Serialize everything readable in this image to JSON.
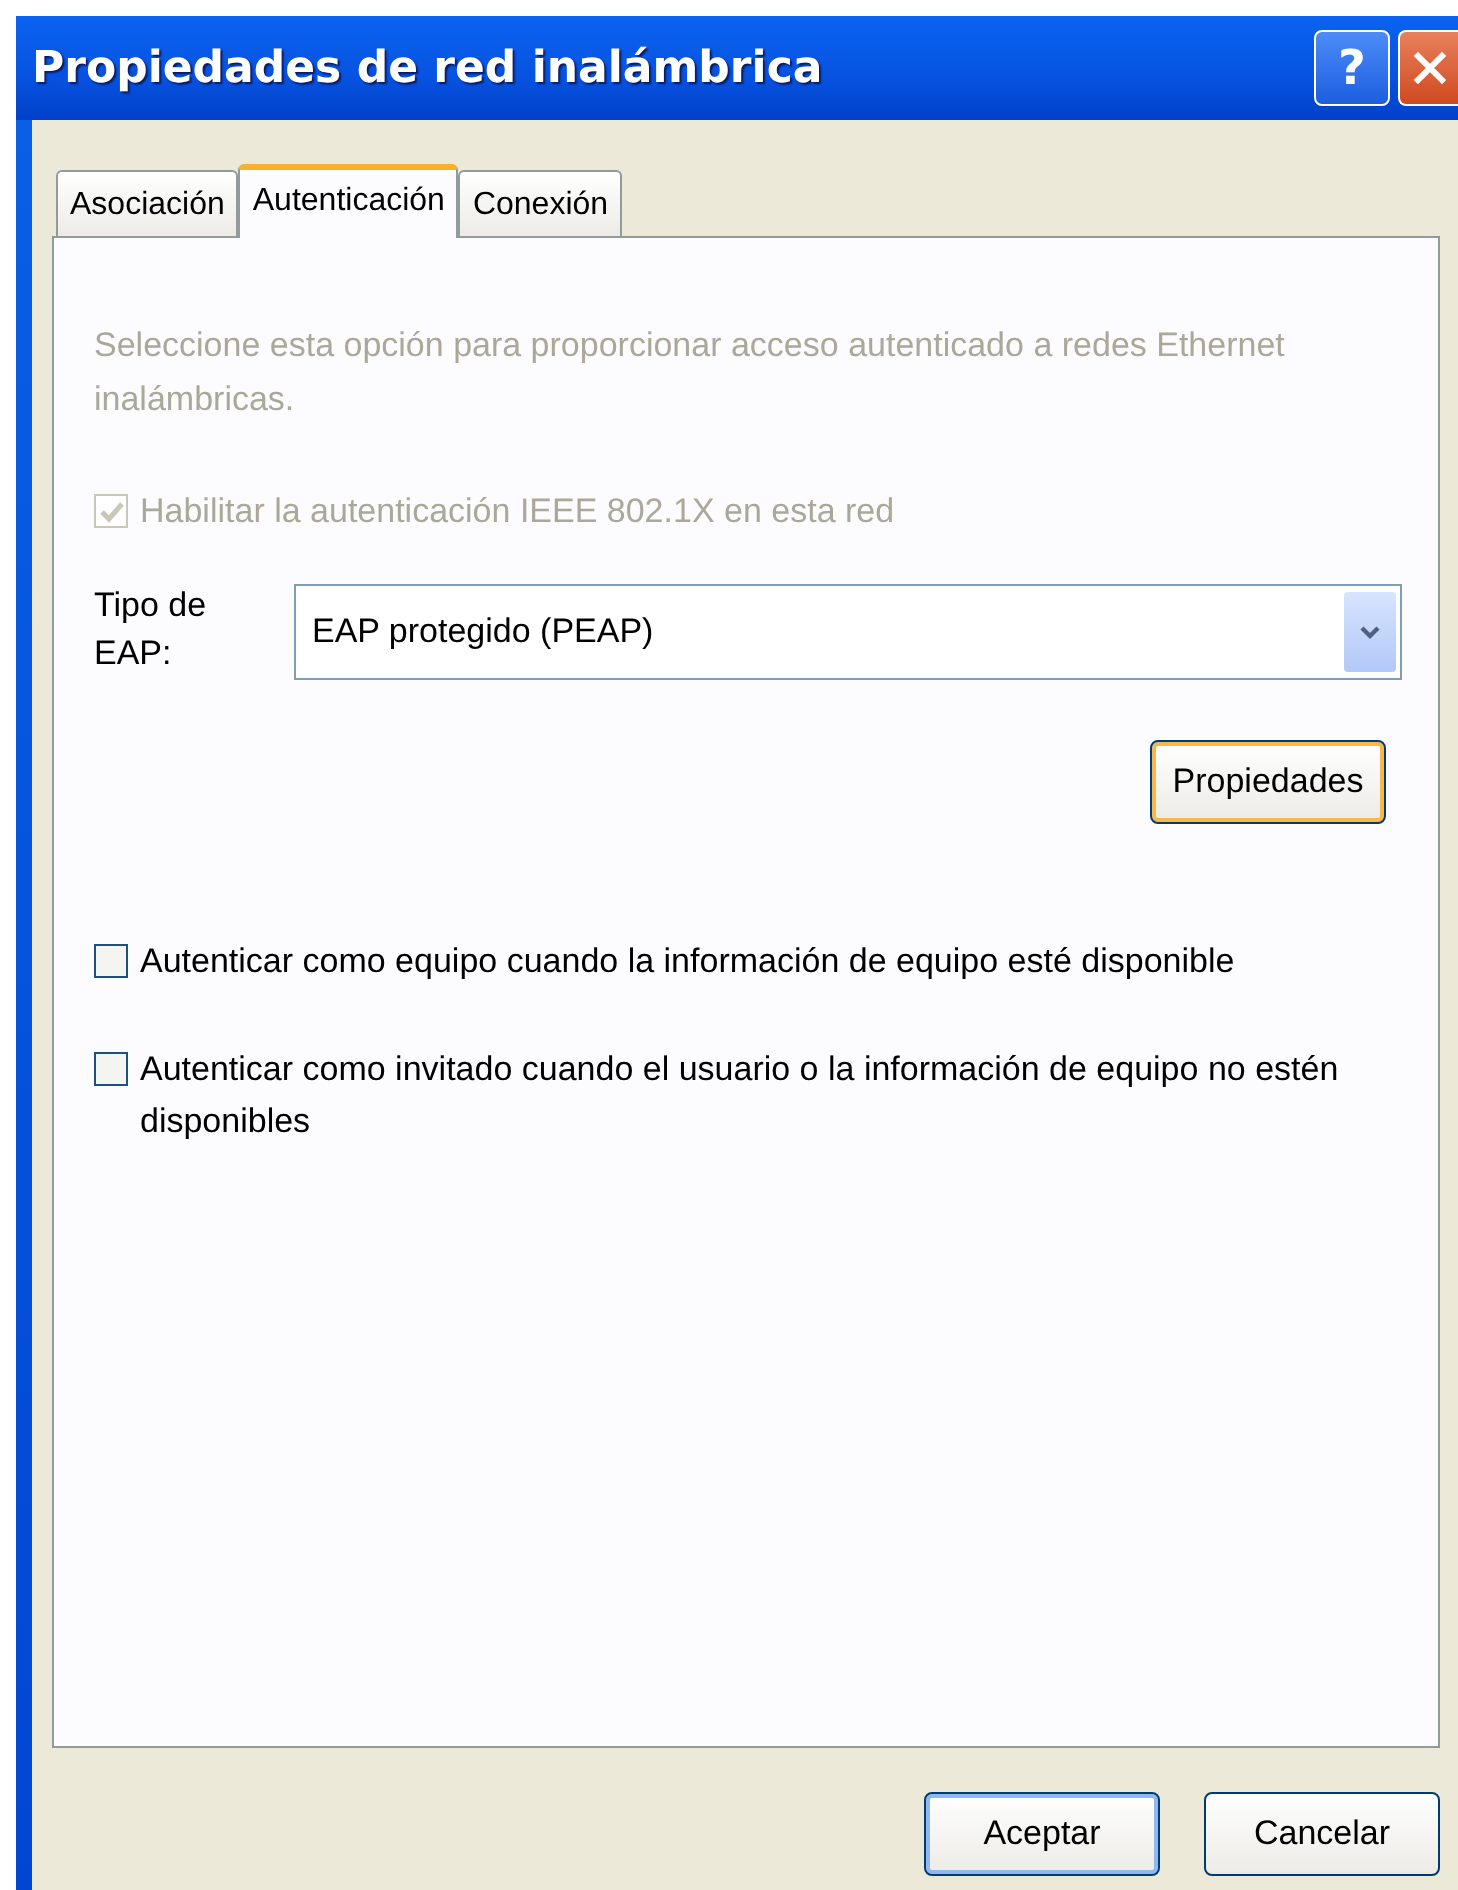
{
  "window": {
    "title": "Propiedades de red inalámbrica",
    "help_button": "?"
  },
  "tabs": [
    {
      "label": "Asociación",
      "selected": false
    },
    {
      "label": "Autenticación",
      "selected": true
    },
    {
      "label": "Conexión",
      "selected": false
    }
  ],
  "description": {
    "text": "Seleccione esta opción para proporcionar acceso autenticado a redes Ethernet inalámbricas.",
    "disabled": true
  },
  "enable_8021x": {
    "label": "Habilitar la autenticación IEEE 802.1X en esta red",
    "checked": true,
    "disabled": true
  },
  "eap_type": {
    "label": "Tipo de EAP:",
    "value": "EAP protegido (PEAP)"
  },
  "properties_button": {
    "label": "Propiedades",
    "focused": true
  },
  "options": [
    {
      "label": "Autenticar como equipo cuando la información de equipo esté disponible",
      "checked": false,
      "disabled": false
    },
    {
      "label": "Autenticar como invitado cuando el usuario o la información de equipo no estén disponibles",
      "checked": false,
      "disabled": false
    }
  ],
  "buttons": [
    {
      "label": "Aceptar",
      "default": true
    },
    {
      "label": "Cancelar",
      "default": false
    }
  ]
}
